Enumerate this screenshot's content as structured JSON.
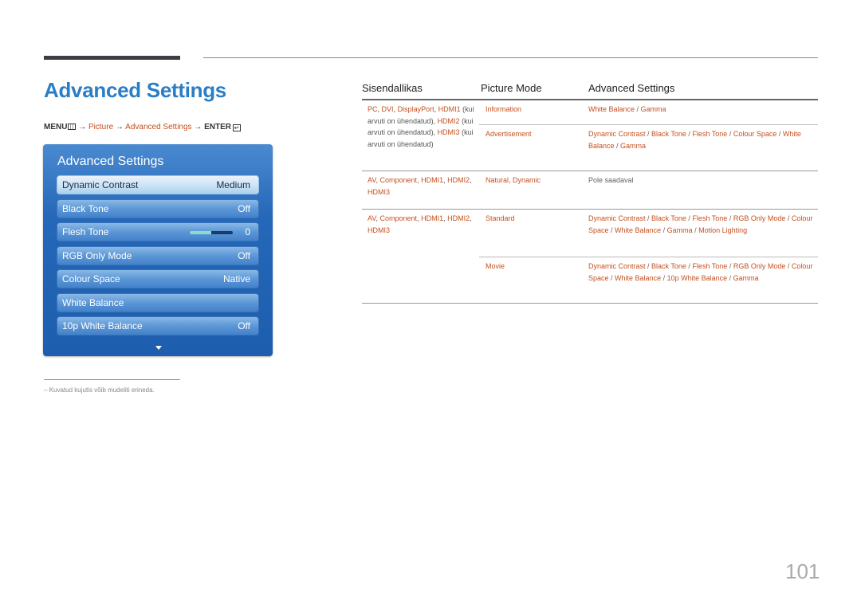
{
  "page": {
    "title": "Advanced Settings",
    "page_number": "101",
    "footnote": "Kuvatud kujutis võib mudeliti erineda.",
    "footnote_dash": "–"
  },
  "breadcrumb": {
    "menu": "MENU",
    "arrow": "→",
    "picture": "Picture",
    "advanced": "Advanced Settings",
    "enter": "ENTER",
    "enter_glyph": "↵"
  },
  "osd": {
    "title": "Advanced Settings",
    "items": [
      {
        "label": "Dynamic Contrast",
        "value": "Medium",
        "selected": true
      },
      {
        "label": "Black Tone",
        "value": "Off"
      },
      {
        "label": "Flesh Tone",
        "value": "0",
        "slider_fraction": 0.5
      },
      {
        "label": "RGB Only Mode",
        "value": "Off"
      },
      {
        "label": "Colour Space",
        "value": "Native"
      },
      {
        "label": "White Balance",
        "value": ""
      },
      {
        "label": "10p White Balance",
        "value": "Off"
      }
    ]
  },
  "table": {
    "headers": [
      "Sisendallikas",
      "Picture Mode",
      "Advanced Settings"
    ],
    "groups": [
      {
        "source_parts": [
          {
            "t": "PC",
            "hl": true
          },
          {
            "t": ", ",
            "hl": false
          },
          {
            "t": "DVI",
            "hl": true
          },
          {
            "t": ", ",
            "hl": false
          },
          {
            "t": "DisplayPort",
            "hl": true
          },
          {
            "t": ", ",
            "hl": false
          },
          {
            "t": "HDMI1",
            "hl": true
          },
          {
            "t": " (kui arvuti on ühendatud), ",
            "hl": false
          },
          {
            "t": "HDMI2",
            "hl": true
          },
          {
            "t": " (kui arvuti on ühendatud), ",
            "hl": false
          },
          {
            "t": "HDMI3",
            "hl": true
          },
          {
            "t": " (kui arvuti on ühendatud)",
            "hl": false
          }
        ],
        "modes": [
          {
            "mode": "Information",
            "settings": [
              "White Balance",
              "Gamma"
            ]
          },
          {
            "mode": "Advertisement",
            "settings": [
              "Dynamic Contrast",
              "Black Tone",
              "Flesh Tone",
              "Colour Space",
              "White Balance",
              "Gamma"
            ]
          }
        ]
      },
      {
        "source_parts": [
          {
            "t": "AV",
            "hl": true
          },
          {
            "t": ", ",
            "hl": false
          },
          {
            "t": "Component",
            "hl": true
          },
          {
            "t": ", ",
            "hl": false
          },
          {
            "t": "HDMI1",
            "hl": true
          },
          {
            "t": ", ",
            "hl": false
          },
          {
            "t": "HDMI2",
            "hl": true
          },
          {
            "t": ", ",
            "hl": false
          },
          {
            "t": "HDMI3",
            "hl": true
          }
        ],
        "modes": [
          {
            "mode": "Natural, Dynamic",
            "settings": [],
            "note": "Pole saadaval"
          }
        ]
      },
      {
        "source_parts": [
          {
            "t": "AV",
            "hl": true
          },
          {
            "t": ", ",
            "hl": false
          },
          {
            "t": "Component",
            "hl": true
          },
          {
            "t": ", ",
            "hl": false
          },
          {
            "t": "HDMI1",
            "hl": true
          },
          {
            "t": ", ",
            "hl": false
          },
          {
            "t": "HDMI2",
            "hl": true
          },
          {
            "t": ", ",
            "hl": false
          },
          {
            "t": "HDMI3",
            "hl": true
          }
        ],
        "modes": [
          {
            "mode": "Standard",
            "settings": [
              "Dynamic Contrast",
              "Black Tone",
              "Flesh Tone",
              "RGB Only Mode",
              "Colour Space",
              "White Balance",
              "Gamma",
              "Motion Lighting"
            ]
          },
          {
            "mode": "Movie",
            "settings": [
              "Dynamic Contrast",
              "Black Tone",
              "Flesh Tone",
              "RGB Only Mode",
              "Colour Space",
              "White Balance",
              "10p White Balance",
              "Gamma"
            ]
          }
        ]
      }
    ]
  }
}
